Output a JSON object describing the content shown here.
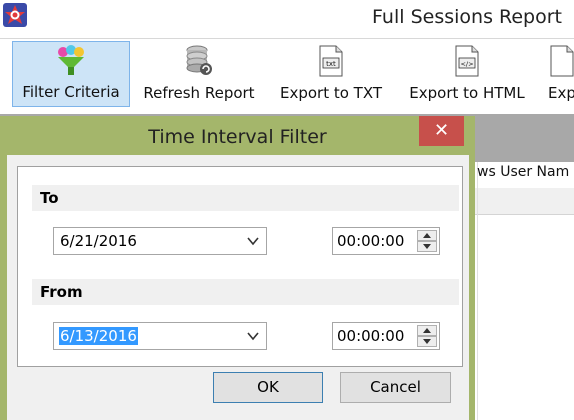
{
  "window": {
    "title": "Full Sessions Report"
  },
  "toolbar": {
    "buttons": [
      {
        "label": "Filter Criteria",
        "icon": "filter-funnel-icon",
        "active": true
      },
      {
        "label": "Refresh Report",
        "icon": "database-refresh-icon",
        "active": false
      },
      {
        "label": "Export to TXT",
        "icon": "txt-file-icon",
        "active": false
      },
      {
        "label": "Export to HTML",
        "icon": "html-file-icon",
        "active": false
      },
      {
        "label": "Exp",
        "icon": "export-file-icon",
        "active": false
      }
    ]
  },
  "grid": {
    "visible_header": "ws User Nam"
  },
  "dialog": {
    "title": "Time Interval Filter",
    "close_glyph": "✕",
    "to": {
      "heading": "To",
      "date": "6/21/2016",
      "time": "00:00:00"
    },
    "from": {
      "heading": "From",
      "date": "6/13/2016",
      "time": "00:00:00"
    },
    "ok_label": "OK",
    "cancel_label": "Cancel"
  },
  "colors": {
    "dialog_frame": "#a4b66b",
    "close_button": "#c7504b",
    "active_toolbar": "#cde4f7",
    "selection": "#3399ff"
  }
}
